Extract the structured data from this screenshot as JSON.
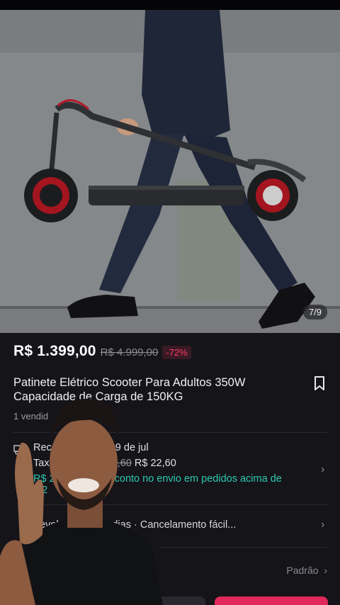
{
  "gallery": {
    "counter": "7/9"
  },
  "price": {
    "current": "R$ 1.399,00",
    "original": "R$ 4.999,00",
    "discount": "-72%"
  },
  "title": "Patinete Elétrico Scooter Para Adultos 350W Capacidade de Carga de 150KG",
  "sold": "1 vendid",
  "shipping": {
    "line1_start": "Rec",
    "line1_end": "9 de jul",
    "fee_label": "Tax",
    "fee_original": "42,60",
    "fee_current": "R$ 22,60",
    "promo_start": "R$ 2",
    "promo_mid": "conto no envio em pedidos acima de",
    "promo_end": "$ 2"
  },
  "returns": "evolu                    as em 30 dias · Cancelamento fácil...",
  "sort_label": "Padrão",
  "colors": {
    "accent": "#e0295a",
    "promo": "#2ec9b0",
    "background": "#151419"
  }
}
